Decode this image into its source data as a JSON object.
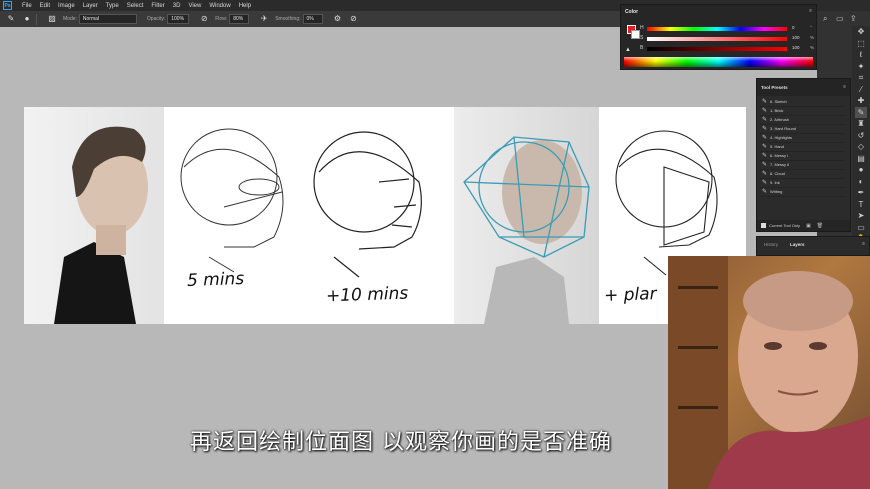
{
  "menu": {
    "logo": "Ps",
    "items": [
      "File",
      "Edit",
      "Image",
      "Layer",
      "Type",
      "Select",
      "Filter",
      "3D",
      "View",
      "Window",
      "Help"
    ]
  },
  "options": {
    "mode_label": "Mode:",
    "mode_value": "Normal",
    "opacity_label": "Opacity:",
    "opacity_value": "100%",
    "flow_label": "Flow:",
    "flow_value": "80%",
    "smoothing_label": "Smoothing:",
    "smoothing_value": "0%"
  },
  "color_panel": {
    "title": "Color",
    "rows": [
      {
        "label": "H",
        "value": "0",
        "unit": "°"
      },
      {
        "label": "S",
        "value": "100",
        "unit": "%"
      },
      {
        "label": "B",
        "value": "100",
        "unit": "%"
      }
    ],
    "foreground": "#e02020",
    "background": "#ffffff"
  },
  "tool_presets": {
    "title": "Tool Presets",
    "items": [
      "6. Sketch",
      "1. Brick",
      "2. Airbrush",
      "3. Hard Round",
      "4. Highlights",
      "5. Hand",
      "6. Messy I",
      "7. Messy II",
      "8. Cloud",
      "9. Ink",
      "Writing"
    ],
    "footer_label": "Current Tool Only"
  },
  "layers": {
    "tabs": [
      "History",
      "Layers"
    ]
  },
  "canvas": {
    "labels": [
      "5 mins",
      "+10 mins",
      "+ plar"
    ]
  },
  "subtitle": "再返回绘制位面图 以观察你画的是否准确",
  "tools": [
    "move-icon",
    "marquee-icon",
    "lasso-icon",
    "magic-wand-icon",
    "crop-icon",
    "eyedropper-icon",
    "healing-icon",
    "brush-icon",
    "stamp-icon",
    "history-brush-icon",
    "eraser-icon",
    "gradient-icon",
    "blur-icon",
    "dodge-icon",
    "pen-icon",
    "type-icon",
    "path-select-icon",
    "shape-icon",
    "hand-icon",
    "zoom-icon"
  ]
}
